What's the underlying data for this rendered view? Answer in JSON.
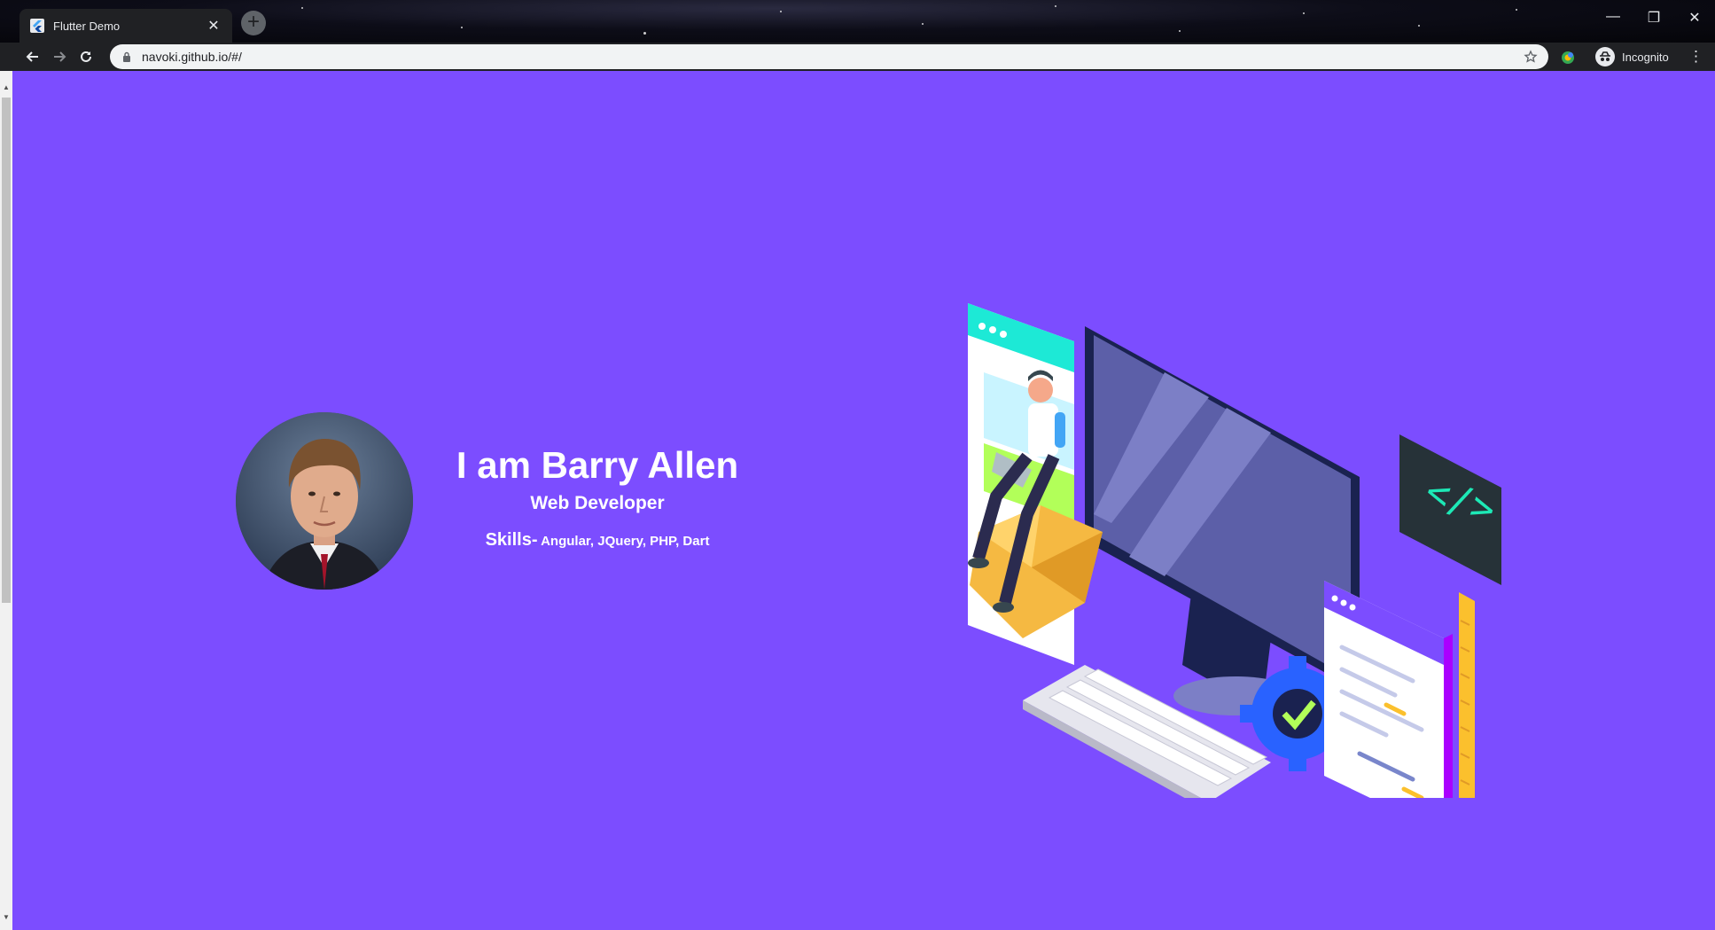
{
  "browser": {
    "tab_title": "Flutter Demo",
    "tab_close": "✕",
    "new_tab": "+",
    "address": "navoki.github.io/#/",
    "profile_label": "Incognito",
    "window_controls": {
      "minimize": "—",
      "restore": "❐",
      "close": "✕"
    },
    "icons": [
      "flutter-icon",
      "back-icon",
      "forward-icon",
      "reload-icon",
      "lock-icon",
      "bookmark-star-icon",
      "extension-icon",
      "incognito-icon",
      "menu-icon"
    ]
  },
  "profile": {
    "name": "I am Barry Allen",
    "role": "Web Developer",
    "skills_label": "Skills-",
    "skills_list": " Angular, JQuery, PHP, Dart"
  },
  "colors": {
    "background": "#7c4dff",
    "text": "#ffffff",
    "chrome": "#202124"
  }
}
